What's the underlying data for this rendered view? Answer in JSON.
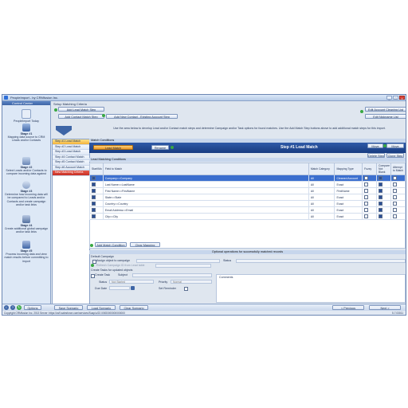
{
  "window": {
    "title": "PeopleImport - by CRMfusion Inc.",
    "controls": [
      "_",
      "□",
      "×"
    ]
  },
  "left_panel": {
    "header": "Control Center",
    "home_label": "PeopleImport Today",
    "stages": [
      {
        "title": "Stage #1",
        "text": "Mapping data source to CRM Leads and/or Contacts"
      },
      {
        "title": "Stage #2",
        "text": "Select Leads and/or Contacts to compare incoming data against"
      },
      {
        "title": "Stage #3",
        "text": "Determine how incoming data will be compared to Leads and/or Contacts and create campaign and/or task links"
      },
      {
        "title": "Stage #4",
        "text": "Create additional global campaign and/or task links"
      },
      {
        "title": "Stage #5",
        "text": "Process incoming data and view match results before committing to import"
      }
    ]
  },
  "setup": {
    "label": "Setup Matching Criteria",
    "buttons": {
      "add_lead_match": "Add Lead Match Step",
      "add_contact_match": "Add Contact Match Step",
      "add_new_contact": "Add New Contact - Existing Account Step",
      "edit_account_cleaning": "Edit Account Cleaning List",
      "edit_nickname": "Edit Nickname List"
    },
    "info": "Use the area below to develop Lead and/or Contact match steps and determine Campaign and/or Task options for found matches. Use the Add Match Step buttons above to add additional match steps for this import."
  },
  "match_steps": [
    {
      "label": "Step #1 Lead Match",
      "state": "active"
    },
    {
      "label": "Step #2 Lead Match",
      "state": "normal"
    },
    {
      "label": "Step #3 Lead Match",
      "state": "normal"
    },
    {
      "label": "Step #4 Contact Match",
      "state": "normal"
    },
    {
      "label": "Step #5 Contact Match",
      "state": "normal"
    },
    {
      "label": "Step #6 Account Match",
      "state": "normal"
    },
    {
      "label": "New Matching Criteria",
      "state": "error"
    }
  ],
  "match_conditions": {
    "header": "Match Conditions",
    "type_button": "Lead Match",
    "rename_button": "Rename",
    "step_title": "Step #1 Lead Match",
    "move_up": "Move",
    "move_down": "Move",
    "delete_step": "Delete Step",
    "clone_step": "Clone Step"
  },
  "lead_matching": {
    "header": "Lead Matching Conditions",
    "columns": [
      "Start/Mo",
      "Field to Match",
      "Match Category",
      "Mapping Type",
      "Fuzzy",
      "Compare Not Blank",
      "Attempt to Match"
    ],
    "rows": [
      {
        "field": "Company==Company",
        "category": "All",
        "mapping": "Cleaned Account",
        "selected": true
      },
      {
        "field": "Last Name==LastName",
        "category": "All",
        "mapping": "Exact",
        "selected": false
      },
      {
        "field": "First Name==FirstName",
        "category": "All",
        "mapping": "FirstName",
        "selected": false
      },
      {
        "field": "State==State",
        "category": "All",
        "mapping": "Exact",
        "selected": false
      },
      {
        "field": "Country==Country",
        "category": "All",
        "mapping": "Exact",
        "selected": false
      },
      {
        "field": "Email Address==Email",
        "category": "All",
        "mapping": "Exact",
        "selected": false
      },
      {
        "field": "City==City",
        "category": "All",
        "mapping": "Exact",
        "selected": false
      }
    ],
    "add_condition": "Add Match Condition",
    "clear_mapping": "Clear Mapping"
  },
  "optional": {
    "header": "Optional operations for successfully matched records",
    "default_campaign": "Default Campaign",
    "assign_campaign": "Assign object to campaign",
    "status_label": "Status",
    "refresh_label": "Refresh Campaign ID from Lead table",
    "create_tasks_header": "Create Tasks for updated objects",
    "create_task": "Create Task",
    "subject_label": "Subject",
    "status2_label": "Status",
    "status2_value": "Not Started",
    "priority_label": "Priority",
    "priority_value": "Normal",
    "due_date_label": "Due Date",
    "set_reminder": "Set Reminder",
    "comments_label": "Comments"
  },
  "bottom_bar": {
    "options": "Options",
    "save_scenario": "Save Scenario",
    "load_scenario": "Load Scenario",
    "clear_scenario": "Clear Scenario",
    "previous": "< Previous",
    "next": "Next >"
  },
  "status_bar": {
    "left": "Copyright CRMfusion Inc. 2013    Server: https://cs9.salesforce.com/services/Soap/u/22.0/00D000000000000",
    "right": "5.7.03011"
  },
  "colors": {
    "accent": "#2f5aa8",
    "active_step": "#f2b23a",
    "error_step": "#c62f24",
    "selected_row": "#3b6fcf",
    "green_indicator": "#3aa843"
  }
}
